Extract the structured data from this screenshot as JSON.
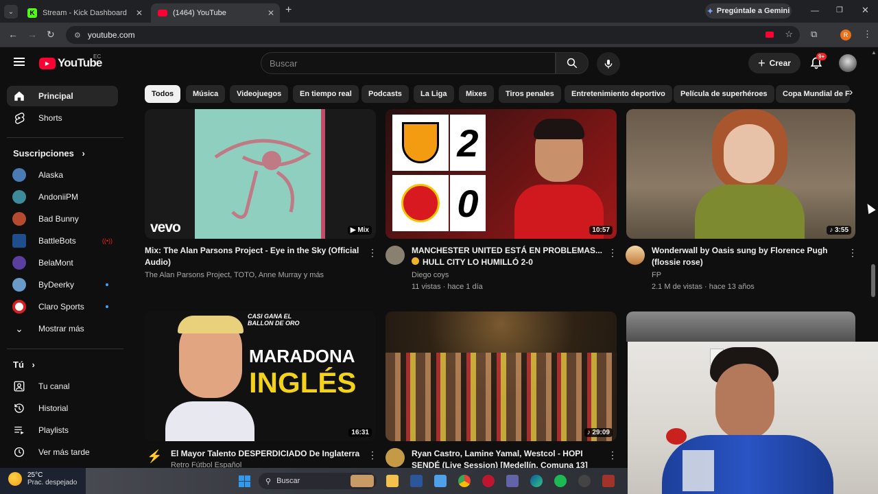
{
  "browser": {
    "tabs": [
      {
        "title": "Stream - Kick Dashboard",
        "color": "#53fc18"
      },
      {
        "title": "(1464) YouTube",
        "color": "#ff0033"
      }
    ],
    "gemini_label": "Pregúntale a Gemini",
    "url": "youtube.com"
  },
  "header": {
    "logo_text": "YouTube",
    "region": "EC",
    "search_placeholder": "Buscar",
    "create_label": "Crear",
    "notif_badge": "9+"
  },
  "sidebar": {
    "main": [
      {
        "label": "Principal",
        "icon": "home-icon"
      },
      {
        "label": "Shorts",
        "icon": "shorts-icon"
      }
    ],
    "subs_title": "Suscripciones",
    "subs": [
      {
        "label": "Alaska",
        "color": "#4a7bb5"
      },
      {
        "label": "AndoniiPM",
        "color": "#3c8a9a"
      },
      {
        "label": "Bad Bunny",
        "color": "#b44a2e"
      },
      {
        "label": "BattleBots",
        "color": "#1f4e8c"
      },
      {
        "label": "BelaMont",
        "color": "#5a3fa0"
      },
      {
        "label": "ByDeerky",
        "color": "#6a9ac8"
      },
      {
        "label": "Claro Sports",
        "color": "#d42020"
      }
    ],
    "more_label": "Mostrar más",
    "you_title": "Tú",
    "you": [
      {
        "label": "Tu canal"
      },
      {
        "label": "Historial"
      },
      {
        "label": "Playlists"
      },
      {
        "label": "Ver más tarde"
      }
    ]
  },
  "chips": [
    "Todos",
    "Música",
    "Videojuegos",
    "En tiempo real",
    "Podcasts",
    "La Liga",
    "Mixes",
    "Tiros penales",
    "Entretenimiento deportivo",
    "Película de superhéroes",
    "Copa Mundial de F"
  ],
  "videos": [
    {
      "title1": "Mix: The Alan Parsons Project - Eye in the Sky (Official",
      "title2": "Audio)",
      "meta1": "The Alan Parsons Project, TOTO, Anne Murray y más",
      "meta2": "",
      "badge": "Mix",
      "vevo": "vevo"
    },
    {
      "title1": "MANCHESTER UNITED ESTÁ EN PROBLEMAS...",
      "title2": "HULL CITY LO HUMILLÓ 2-0",
      "meta1": "Diego coys",
      "meta2": "11 vistas · hace 1 día",
      "badge": "10:57",
      "score_top": "2",
      "score_bottom": "0"
    },
    {
      "title1": "Wonderwall by Oasis sung by Florence Pugh",
      "title2": "(flossie rose)",
      "meta1": "FP",
      "meta2": "2.1 M de vistas · hace 13 años",
      "badge": "3:55"
    },
    {
      "title1": "El Mayor Talento DESPERDICIADO De Inglaterra",
      "title2": "",
      "meta1": "Retro Fútbol Español",
      "meta2": "",
      "badge": "16:31",
      "overlay1": "MARADONA",
      "overlay2": "INGLÉS",
      "overlay_small": "CASI GANA EL BALLON DE ORO"
    },
    {
      "title1": "Ryan Castro, Lamine Yamal, Westcol - HOPI",
      "title2": "SENDÉ (Live Session) [Medellín, Comuna 13]",
      "meta1": "",
      "meta2": "",
      "badge": "29:09"
    }
  ],
  "taskbar": {
    "temp": "25°C",
    "weather": "Prac. despejado",
    "search": "Buscar"
  }
}
